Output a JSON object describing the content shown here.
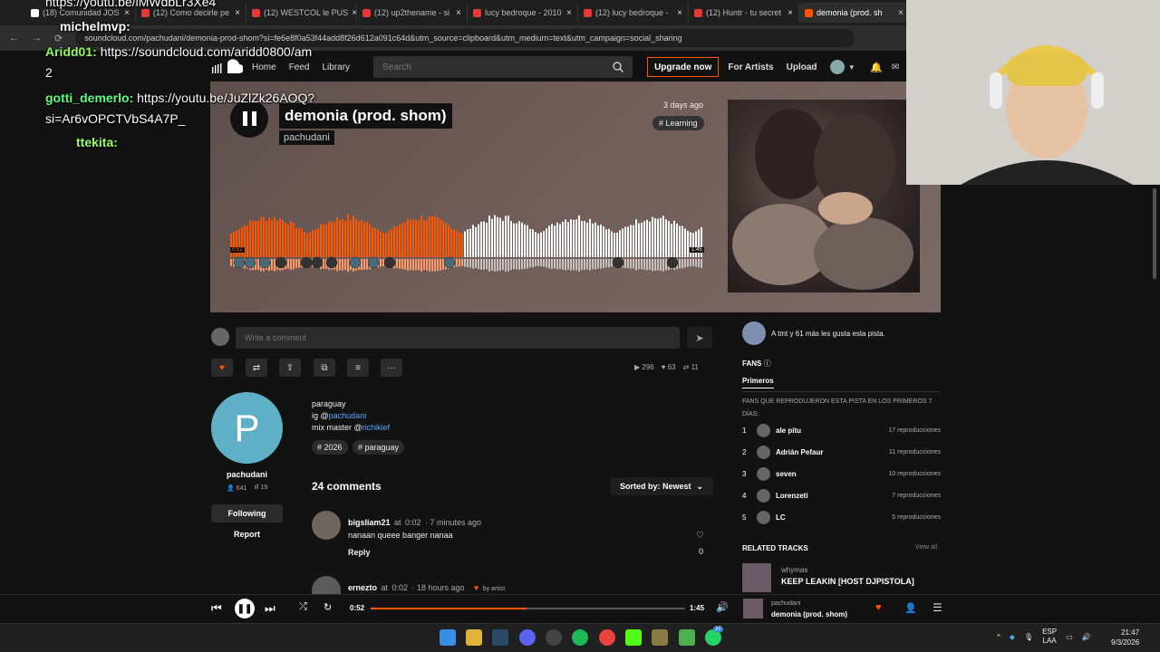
{
  "browser": {
    "tabs": [
      {
        "label": "(18) Comunidad JOS",
        "icon": "x-icon"
      },
      {
        "label": "(12) Como decirle pe",
        "icon": "youtube-icon"
      },
      {
        "label": "(12) WESTCOL le PUS",
        "icon": "youtube-icon"
      },
      {
        "label": "(12) up2thename - si",
        "icon": "youtube-icon"
      },
      {
        "label": "lucy bedroque - 2010",
        "icon": "youtube-icon"
      },
      {
        "label": "(12) lucy bedroque -",
        "icon": "youtube-icon"
      },
      {
        "label": "(12) Huntr - tu secret",
        "icon": "youtube-icon"
      },
      {
        "label": "demonia (prod. sh",
        "icon": "soundcloud-icon",
        "active": true
      }
    ],
    "url": "soundcloud.com/pachudani/demonia-prod-shom?si=fe6e8f0a53f44add8f26d612a091c64d&utm_source=clipboard&utm_medium=text&utm_campaign=social_sharing"
  },
  "chat": [
    {
      "user": "",
      "text": "https://youtu.be/iMWdbLr3Xe4"
    },
    {
      "user": "michelmvp:",
      "text": ""
    },
    {
      "user": "Aridd01:",
      "text": "https://soundcloud.com/aridd0800/am"
    },
    {
      "user": "",
      "text": "2"
    },
    {
      "user": "gotti_demerlo:",
      "text": "https://youtu.be/JuZlZk26AOQ?"
    },
    {
      "user": "",
      "text": "si=Ar6vOPCTVbS4A7P_"
    },
    {
      "user": "ttekita:",
      "text": ""
    }
  ],
  "header": {
    "nav": [
      "Home",
      "Feed",
      "Library"
    ],
    "search_placeholder": "Search",
    "upgrade": "Upgrade now",
    "for_artists": "For Artists",
    "upload": "Upload"
  },
  "track": {
    "title": "demonia (prod. shom)",
    "artist": "pachudani",
    "posted": "3 days ago",
    "genre": "# Learning",
    "elapsed_marker": "0:52",
    "duration_marker": "1:45",
    "progress": 0.495
  },
  "comment_box": {
    "placeholder": "Write a comment"
  },
  "stats": {
    "plays": "296",
    "likes": "63",
    "reposts": "11"
  },
  "profile": {
    "initial": "P",
    "name": "pachudani",
    "followers": "641",
    "tracks": "19",
    "following_label": "Following",
    "report_label": "Report"
  },
  "description": {
    "line1": "paraguay",
    "line2_prefix": "ig @",
    "line2_link": "pachudani",
    "line3_prefix": "mix master @",
    "line3_link": "richikief",
    "tags": [
      "# 2026",
      "# paraguay"
    ]
  },
  "comments": {
    "count_label": "24 comments",
    "sort_label": "Sorted by: Newest",
    "items": [
      {
        "user": "bigsliam21",
        "at": "at",
        "time": "0:02",
        "ago": "· 7 minutes ago",
        "text": "nanaan queee banger nanaa",
        "reply": "Reply",
        "likes": "0"
      },
      {
        "user": "ernezto",
        "at": "at",
        "time": "0:02",
        "ago": "· 18 hours ago",
        "liked_by": "by artist"
      }
    ]
  },
  "sidebar": {
    "likers_text": "A tmt y 61 más les gusta esta pista.",
    "likers_user": "tmt",
    "fans_title": "FANS",
    "fans_tab": "Primeros",
    "fans_desc": "FANS QUE REPRODUJERON ESTA PISTA EN LOS PRIMEROS 7 DÍAS:",
    "fans": [
      {
        "rank": "1",
        "name": "ale pitu",
        "plays": "17 reproducciones"
      },
      {
        "rank": "2",
        "name": "Adrián Pefaur",
        "plays": "11 reproducciones"
      },
      {
        "rank": "3",
        "name": "seven",
        "plays": "10 reproducciones"
      },
      {
        "rank": "4",
        "name": "Lorenzeti",
        "plays": "7 reproducciones"
      },
      {
        "rank": "5",
        "name": "LC",
        "plays": "5 reproducciones"
      }
    ],
    "related_title": "RELATED TRACKS",
    "view_all": "View all",
    "related": {
      "artist": "whymas",
      "title": "KEEP LEAKIN [HOST DJPISTOLA]"
    }
  },
  "player": {
    "elapsed": "0:52",
    "duration": "1:45",
    "progress": 0.495,
    "artist": "pachudani",
    "title": "demonia (prod. shom)"
  },
  "taskbar": {
    "lang1": "ESP",
    "lang2": "LAA",
    "time": "21:47",
    "date": "9/3/2026",
    "badge": "37"
  },
  "colors": {
    "accent": "#ff5500",
    "bg": "#121212",
    "link": "#5aa7ff"
  }
}
